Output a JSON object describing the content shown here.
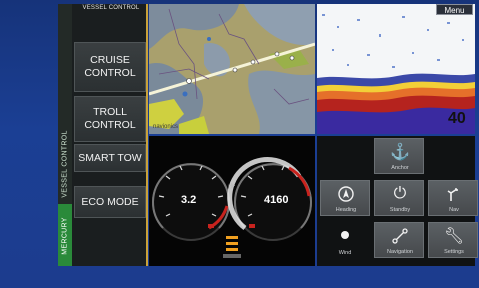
{
  "vessel_panel": {
    "title": "VESSEL CONTROL",
    "side_label": "VESSEL CONTROL",
    "brand_label": "MERCURY",
    "buttons": [
      "CRUISE CONTROL",
      "TROLL CONTROL",
      "SMART TOW",
      "ECO MODE"
    ]
  },
  "sonar": {
    "menu_label": "Menu",
    "depth": "40"
  },
  "chart": {
    "watermark": "navionics"
  },
  "gauges": {
    "speed": "3.2",
    "rpm": "4160"
  },
  "autopilot": {
    "buttons": [
      {
        "label": "Anchor",
        "icon": "anchor-icon"
      },
      {
        "label": "Heading",
        "icon": "heading-icon"
      },
      {
        "label": "Standby",
        "icon": "power-icon"
      },
      {
        "label": "Nav",
        "icon": "route-icon"
      },
      {
        "label": "Wind",
        "icon": "dot-icon"
      },
      {
        "label": "Navigation",
        "icon": "waypoint-route-icon"
      },
      {
        "label": "Settings",
        "icon": "wrench-icon"
      }
    ]
  },
  "colors": {
    "accent": "#c9a23a",
    "brand_green": "#2a8a3a",
    "background": "#1b3f94"
  }
}
